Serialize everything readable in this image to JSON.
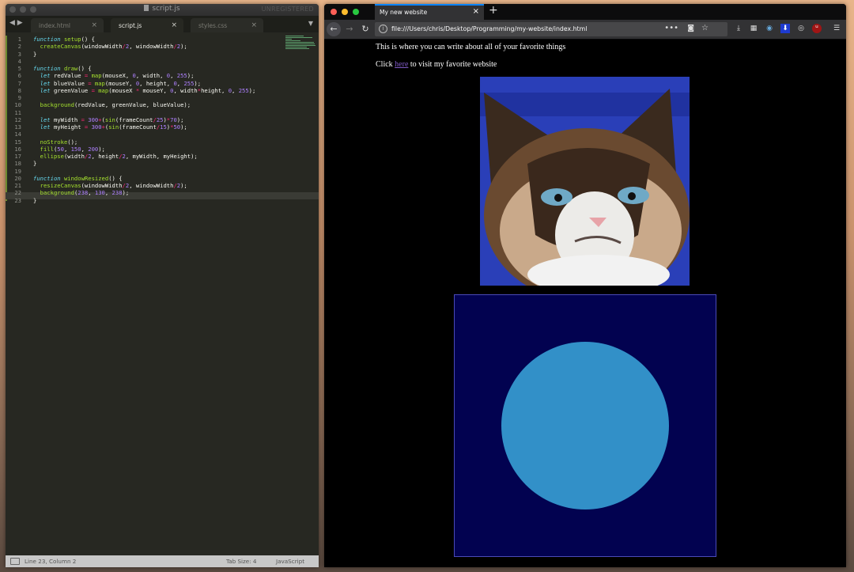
{
  "editor": {
    "title": "script.js",
    "unregistered": "UNREGISTERED",
    "tabs": [
      {
        "label": "index.html",
        "active": false
      },
      {
        "label": "script.js",
        "active": true
      },
      {
        "label": "styles.css",
        "active": false
      }
    ],
    "code_lines": [
      "function setup() {",
      "  createCanvas(windowWidth/2, windowWidth/2);",
      "}",
      "",
      "function draw() {",
      "  let redValue = map(mouseX, 0, width, 0, 255);",
      "  let blueValue = map(mouseY, 0, height, 0, 255);",
      "  let greenValue = map(mouseX * mouseY, 0, width*height, 0, 255);",
      "",
      "  background(redValue, greenValue, blueValue);",
      "",
      "  let myWidth = 300+(sin(frameCount/25)*70);",
      "  let myHeight = 300+(sin(frameCount/15)*50);",
      "",
      "  noStroke();",
      "  fill(50, 150, 200);",
      "  ellipse(width/2, height/2, myWidth, myHeight);",
      "}",
      "",
      "function windowResized() {",
      "  resizeCanvas(windowWidth/2, windowWidth/2);",
      "  background(238, 130, 238);",
      "}"
    ],
    "status": {
      "position": "Line 23, Column 2",
      "tab_size": "Tab Size: 4",
      "syntax": "JavaScript"
    }
  },
  "browser": {
    "tab_title": "My new website",
    "url": "file:///Users/chris/Desktop/Programming/my-website/index.html",
    "page": {
      "paragraph1": "This is where you can write about all of your favorite things",
      "click_prefix": "Click ",
      "link_text": "here",
      "click_suffix": " to visit my favorite website",
      "image_alt": "grumpy cat photo"
    },
    "canvas": {
      "background": "#020250",
      "ellipse_fill": "#3290c8"
    }
  },
  "colors": {
    "editor_bg": "#272822",
    "keyword": "#66d9ef",
    "function": "#a6e22e",
    "number": "#ae81ff",
    "operator": "#f92672",
    "accent": "#0a84ff"
  }
}
